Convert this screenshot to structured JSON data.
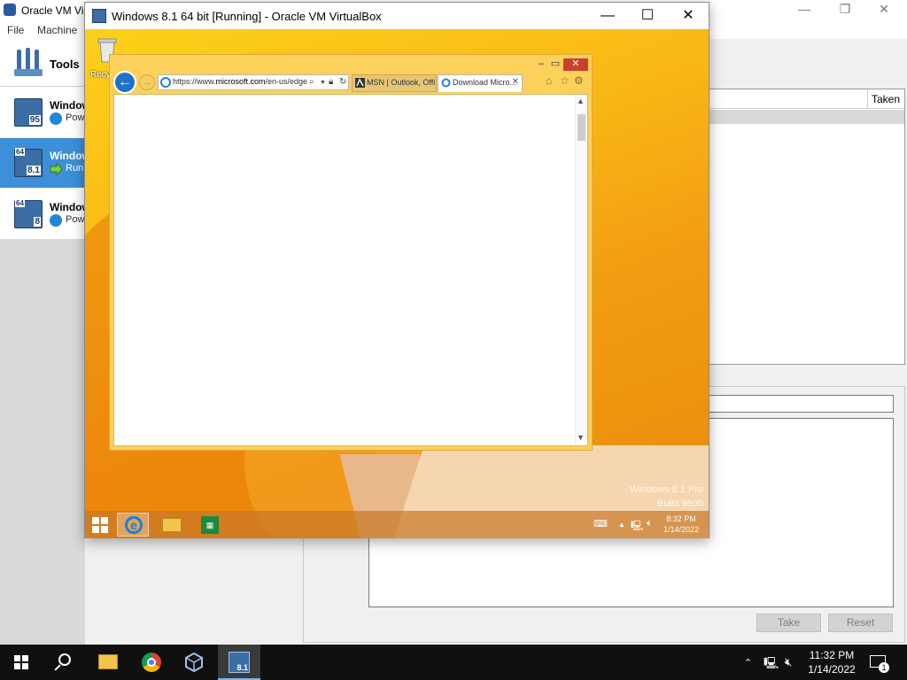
{
  "manager": {
    "title": "Oracle VM Vir",
    "menu": [
      "File",
      "Machine"
    ],
    "tools_label": "Tools",
    "vms": [
      {
        "name": "Window",
        "state": "Pow",
        "version": "95",
        "badge": ""
      },
      {
        "name": "Window",
        "state": "Run",
        "version": "8.1",
        "badge": "64"
      },
      {
        "name": "Window",
        "state": "Pow",
        "version": "8",
        "badge": "64"
      }
    ],
    "snapshot_column_taken": "Taken",
    "take_button": "Take",
    "reset_button": "Reset"
  },
  "vm_window": {
    "title": "Windows 8.1 64 bit [Running] - Oracle VM VirtualBox",
    "guest": {
      "recycle_bin_label": "Recy",
      "ie": {
        "address": "https://www.microsoft.com/en-us/edge",
        "address_prefix": "https://www.",
        "address_domain": "microsoft.com",
        "address_path": "/en-us/edge",
        "tabs": [
          {
            "label": "MSN | Outlook, Offi..."
          },
          {
            "label": "Download Micro..."
          }
        ],
        "content_bg": "#ffffff"
      },
      "watermark_line1": "Windows 8.1 Pro",
      "watermark_line2": "Build 9600",
      "clock_time": "8:32 PM",
      "clock_date": "1/14/2022"
    }
  },
  "host_taskbar": {
    "clock_time": "11:32 PM",
    "clock_date": "1/14/2022",
    "notification_count": "1",
    "vm_task_badge": "8.1"
  },
  "colors": {
    "selection_blue": "#3d8fd9",
    "guest_orange": "#f9b715",
    "host_taskbar": "#101010"
  }
}
